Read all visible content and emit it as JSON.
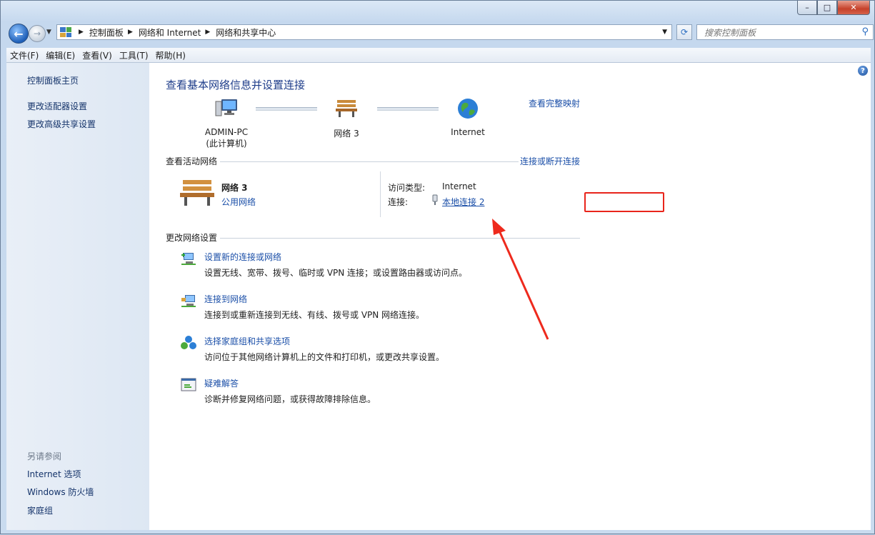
{
  "window": {
    "controls": {
      "minimize": "–",
      "maximize": "□",
      "close": "✕"
    }
  },
  "nav": {
    "breadcrumb": [
      "控制面板",
      "网络和 Internet",
      "网络和共享中心"
    ],
    "search_placeholder": "搜索控制面板"
  },
  "menu": [
    "文件(F)",
    "编辑(E)",
    "查看(V)",
    "工具(T)",
    "帮助(H)"
  ],
  "sidebar": {
    "items": [
      "控制面板主页",
      "更改适配器设置",
      "更改高级共享设置"
    ],
    "see_also_label": "另请参阅",
    "see_also": [
      "Internet 选项",
      "Windows 防火墙",
      "家庭组"
    ]
  },
  "main": {
    "title": "查看基本网络信息并设置连接",
    "full_map_link": "查看完整映射",
    "map_nodes": [
      {
        "line1": "ADMIN-PC",
        "line2": "(此计算机)"
      },
      {
        "line1": "网络  3",
        "line2": ""
      },
      {
        "line1": "Internet",
        "line2": ""
      }
    ],
    "active_header": "查看活动网络",
    "connect_link": "连接或断开连接",
    "network_name": "网络  3",
    "network_type": "公用网络",
    "access_type_label": "访问类型:",
    "access_type_value": "Internet",
    "connection_label": "连接:",
    "connection_value": "本地连接 2",
    "change_header": "更改网络设置",
    "tasks": [
      {
        "title": "设置新的连接或网络",
        "desc": "设置无线、宽带、拨号、临时或 VPN 连接；或设置路由器或访问点。"
      },
      {
        "title": "连接到网络",
        "desc": "连接到或重新连接到无线、有线、拨号或 VPN 网络连接。"
      },
      {
        "title": "选择家庭组和共享选项",
        "desc": "访问位于其他网络计算机上的文件和打印机，或更改共享设置。"
      },
      {
        "title": "疑难解答",
        "desc": "诊断并修复网络问题，或获得故障排除信息。"
      }
    ]
  },
  "colors": {
    "link": "#1b4fa8",
    "title": "#1e3d8a",
    "highlight": "#e8241b"
  }
}
